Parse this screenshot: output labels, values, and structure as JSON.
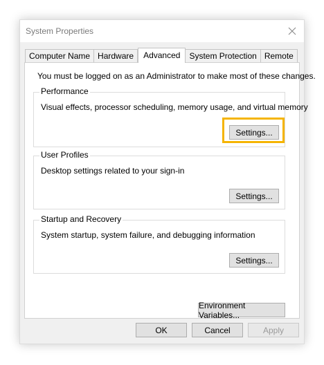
{
  "window": {
    "title": "System Properties"
  },
  "tabs": [
    {
      "label": "Computer Name",
      "active": false
    },
    {
      "label": "Hardware",
      "active": false
    },
    {
      "label": "Advanced",
      "active": true
    },
    {
      "label": "System Protection",
      "active": false
    },
    {
      "label": "Remote",
      "active": false
    }
  ],
  "advanced": {
    "admin_note": "You must be logged on as an Administrator to make most of these changes.",
    "performance": {
      "title": "Performance",
      "description": "Visual effects, processor scheduling, memory usage, and virtual memory",
      "button": "Settings..."
    },
    "user_profiles": {
      "title": "User Profiles",
      "description": "Desktop settings related to your sign-in",
      "button": "Settings..."
    },
    "startup_recovery": {
      "title": "Startup and Recovery",
      "description": "System startup, system failure, and debugging information",
      "button": "Settings..."
    },
    "env_button": "Environment Variables..."
  },
  "footer": {
    "ok": "OK",
    "cancel": "Cancel",
    "apply": "Apply"
  },
  "colors": {
    "highlight": "#f5b400",
    "panel": "#ffffff",
    "window": "#f0f0f0"
  },
  "icons": {
    "close": "close-icon"
  }
}
